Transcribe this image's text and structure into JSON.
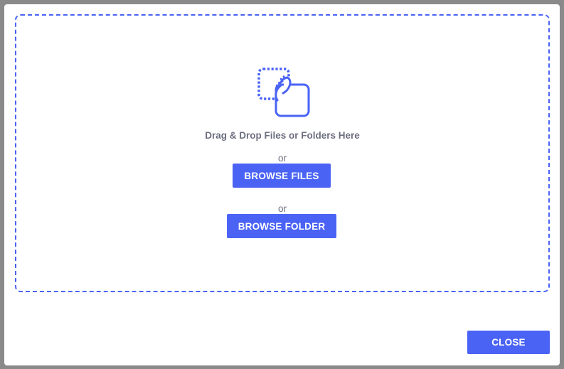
{
  "dropzone": {
    "icon": "drag-drop-hand-icon",
    "instruction": "Drag & Drop Files or Folders Here",
    "or_1": "or",
    "or_2": "or",
    "browse_files_label": "BROWSE FILES",
    "browse_folder_label": "BROWSE FOLDER"
  },
  "footer": {
    "close_label": "CLOSE"
  },
  "colors": {
    "accent": "#4a63f5",
    "text_muted": "#6d6f80",
    "backdrop": "#8a8a8a"
  }
}
